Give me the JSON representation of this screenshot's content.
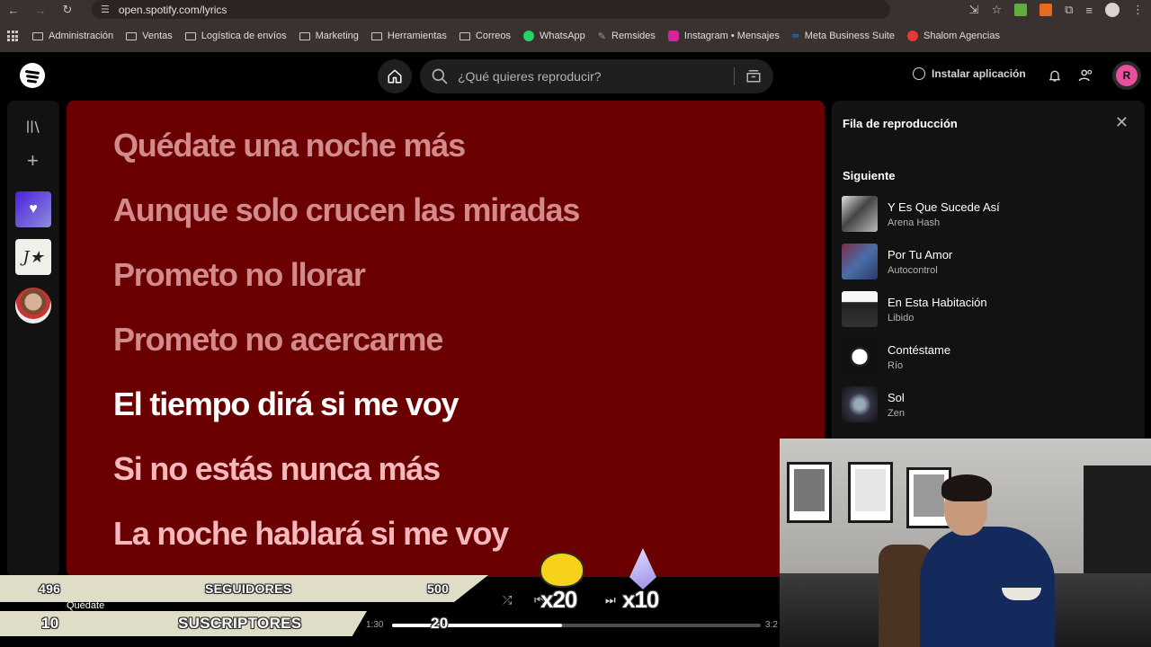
{
  "browser": {
    "url": "open.spotify.com/lyrics",
    "bookmarks": [
      "Administración",
      "Ventas",
      "Logística de envíos",
      "Marketing",
      "Herramientas",
      "Correos",
      "WhatsApp",
      "Remsides",
      "Instagram • Mensajes",
      "Meta Business Suite",
      "Shalom Agencias"
    ]
  },
  "topbar": {
    "search_placeholder": "¿Qué quieres reproducir?",
    "install_label": "Instalar aplicación",
    "avatar_initial": "R"
  },
  "lyrics": {
    "lines": [
      "Quédate una noche más",
      "Aunque solo crucen las miradas",
      "Prometo no llorar",
      "Prometo no acercarme",
      "El tiempo dirá si me voy",
      "Si no estás nunca más",
      "La noche hablará si me voy"
    ],
    "current_index": 4,
    "bg_color": "#6b0000"
  },
  "queue": {
    "title": "Fila de reproducción",
    "section": "Siguiente",
    "items": [
      {
        "title": "Y Es Que Sucede Así",
        "artist": "Arena Hash"
      },
      {
        "title": "Por Tu Amor",
        "artist": "Autocontrol"
      },
      {
        "title": "En Esta Habitación",
        "artist": "Libido"
      },
      {
        "title": "Contéstame",
        "artist": "Río"
      },
      {
        "title": "Sol",
        "artist": "Zen"
      }
    ]
  },
  "overlay": {
    "followers_current": "496",
    "followers_label": "SEGUIDORES",
    "followers_goal": "500",
    "subs_current": "10",
    "subs_label": "SUSCRIPTORES",
    "subs_goal": "20",
    "multiplier_a": "x20",
    "multiplier_b": "x10"
  },
  "player": {
    "now_playing": "Quédate",
    "elapsed": "1:30",
    "duration": "3:2",
    "progress": 0.46
  },
  "colors": {
    "spotify_green": "#1ed760",
    "accent_pink": "#e8509b",
    "lyric_past": "#d38a8c",
    "lyric_current": "#ffffff",
    "lyric_future": "#f6b8bd"
  }
}
